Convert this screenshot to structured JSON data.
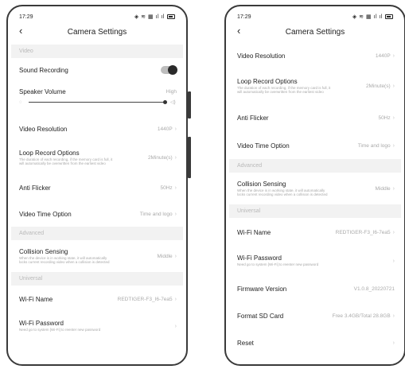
{
  "status": {
    "time": "17:29",
    "icons_text": "% ≡ ≡ ˚l ˚l"
  },
  "nav": {
    "back": "‹",
    "title": "Camera Settings"
  },
  "left": {
    "video_section": "Video",
    "sound_recording": {
      "label": "Sound Recording",
      "on": true
    },
    "speaker_volume": {
      "label": "Speaker Volume",
      "value": "High",
      "level": 1.0
    },
    "video_resolution": {
      "label": "Video Resolution",
      "value": "1440P"
    },
    "loop_record": {
      "label": "Loop Record Options",
      "desc": "The duration of each recording, if the memory card is full, it will automatically be overwritten from the earliest video",
      "value": "2Minute(s)"
    },
    "anti_flicker": {
      "label": "Anti Flicker",
      "value": "50Hz"
    },
    "video_time_option": {
      "label": "Video Time Option",
      "value": "Time and logo"
    },
    "advanced_section": "Advanced",
    "collision": {
      "label": "Collision Sensing",
      "desc": "When the device is in working state, it will automatically locks current recording video when a collision is detected",
      "value": "Middle"
    },
    "universal_section": "Universal",
    "wifi_name": {
      "label": "Wi-Fi Name",
      "value": "REDTIGER-F3_I6-7ea5"
    },
    "wifi_password": {
      "label": "Wi-Fi Password",
      "desc": "Need go to system [Wi-Fi] to reenter new password"
    }
  },
  "right": {
    "video_resolution": {
      "label": "Video Resolution",
      "value": "1440P"
    },
    "loop_record": {
      "label": "Loop Record Options",
      "desc": "The duration of each recording, if the memory card is full, it will automatically be overwritten from the earliest video",
      "value": "2Minute(s)"
    },
    "anti_flicker": {
      "label": "Anti Flicker",
      "value": "50Hz"
    },
    "video_time_option": {
      "label": "Video Time Option",
      "value": "Time and logo"
    },
    "advanced_section": "Advanced",
    "collision": {
      "label": "Collision Sensing",
      "desc": "When the device is in working state, it will automatically locks current recording video when a collision is detected",
      "value": "Middle"
    },
    "universal_section": "Universal",
    "wifi_name": {
      "label": "Wi-Fi Name",
      "value": "REDTIGER-F3_I6-7ea5"
    },
    "wifi_password": {
      "label": "Wi-Fi Password",
      "desc": "Need go to system [Wi-Fi] to reenter new password"
    },
    "firmware": {
      "label": "Firmware Version",
      "value": "V1.0.8_20220721"
    },
    "format_sd": {
      "label": "Format SD Card",
      "value": "Free 3.4GB/Total 28.8GB"
    },
    "reset": {
      "label": "Reset"
    }
  },
  "chevron": "›",
  "colors": {
    "section_bg": "#f2f2f2",
    "muted": "#aaaaaa",
    "text": "#222222",
    "frame": "#3a3a3a"
  }
}
